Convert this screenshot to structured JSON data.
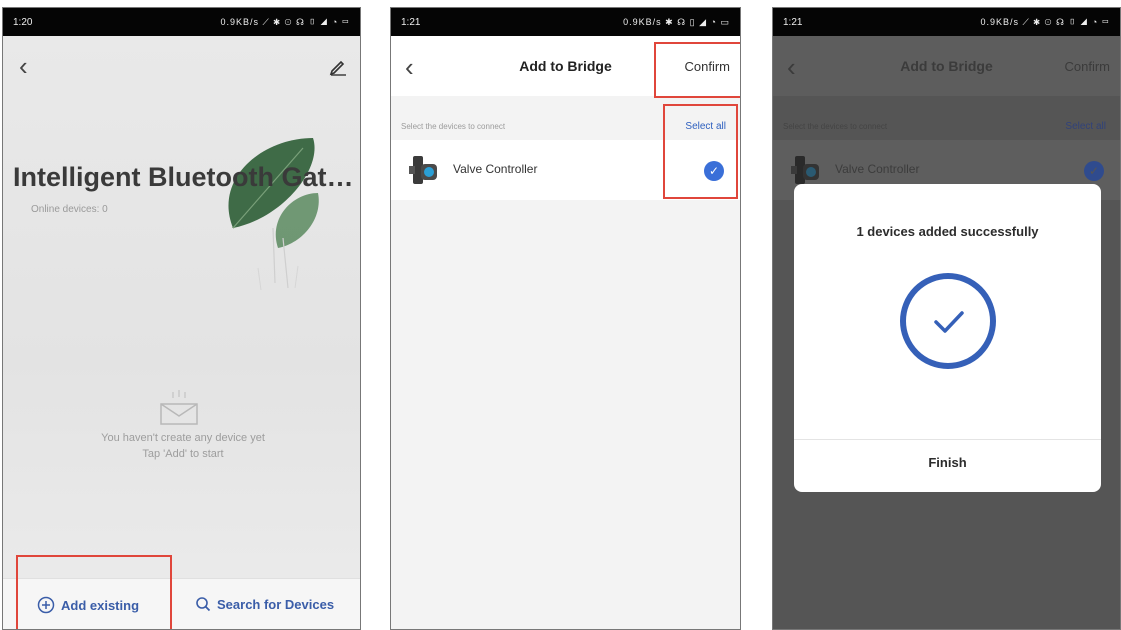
{
  "phone1": {
    "status": {
      "time": "1:20",
      "icons": "0.9KB/s ⟋ ✱ ⊙ ☊ ▯ ◢ ◔ ▭"
    },
    "title": "Intelligent Bluetooth Gat…",
    "online": "Online devices: 0",
    "empty_line1": "You haven't create any device yet",
    "empty_line2": "Tap 'Add' to start",
    "add_existing": "Add existing",
    "search_devices": "Search for Devices",
    "icons": {
      "back": "back-chevron-icon",
      "edit": "pencil-icon",
      "add": "plus-circle-icon",
      "search": "search-icon",
      "empty": "empty-box-icon"
    }
  },
  "phone2": {
    "status": {
      "time": "1:21",
      "icons": "0.9KB/s ✱ ☊ ▯ ◢ ◔ ▭"
    },
    "title": "Add to Bridge",
    "confirm": "Confirm",
    "hint": "Select the devices to connect",
    "select_all": "Select all",
    "device": "Valve Controller"
  },
  "phone3": {
    "status": {
      "time": "1:21",
      "icons": "0.9KB/s ⟋ ✱ ⊙ ☊ ▯ ◢ ◔ ▭"
    },
    "title": "Add to Bridge",
    "confirm": "Confirm",
    "hint": "Select the devices to connect",
    "select_all": "Select all",
    "device": "Valve Controller",
    "dialog_title": "1 devices added successfully",
    "finish": "Finish"
  },
  "colors": {
    "highlight": "#e0463b",
    "accent": "#3a6fd8",
    "link": "#3a5da8"
  }
}
